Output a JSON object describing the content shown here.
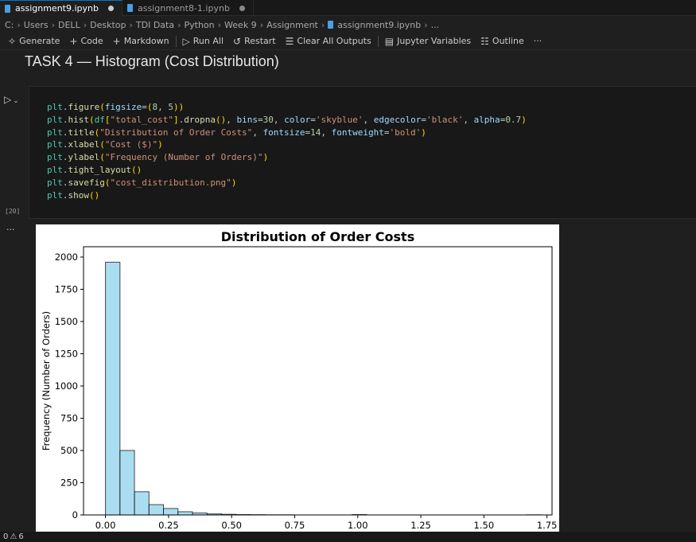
{
  "tabs": [
    {
      "label": "assignment9.ipynb"
    },
    {
      "label": "assignment8-1.ipynb"
    }
  ],
  "breadcrumb": [
    "C:",
    "Users",
    "DELL",
    "Desktop",
    "TDI Data",
    "Python",
    "Week 9",
    "Assignment",
    "assignment9.ipynb",
    "..."
  ],
  "toolbar": {
    "generate": "Generate",
    "code": "Code",
    "markdown": "Markdown",
    "run_all": "Run All",
    "restart": "Restart",
    "clear_all": "Clear All Outputs",
    "jupyter_vars": "Jupyter Variables",
    "outline": "Outline",
    "more": "···"
  },
  "markdown_heading": "TASK 4 — Histogram (Cost Distribution)",
  "cell": {
    "execution_count": "[20]",
    "code_lines": [
      "plt.figure(figsize=(8, 5))",
      "plt.hist(df[\"total_cost\"].dropna(), bins=30, color='skyblue', edgecolor='black', alpha=0.7)",
      "plt.title(\"Distribution of Order Costs\", fontsize=14, fontweight='bold')",
      "plt.xlabel(\"Cost ($)\")",
      "plt.ylabel(\"Frequency (Number of Orders)\")",
      "plt.tight_layout()",
      "plt.savefig(\"cost_distribution.png\")",
      "plt.show()"
    ]
  },
  "output_dots": "···",
  "chart_data": {
    "type": "bar",
    "title": "Distribution of Order Costs",
    "xlabel": "",
    "ylabel": "Frequency (Number of Orders)",
    "xlim": [
      -0.087,
      1.77
    ],
    "ylim": [
      0,
      2080
    ],
    "xticks": [
      "0.00",
      "0.25",
      "0.50",
      "0.75",
      "1.00",
      "1.25",
      "1.50",
      "1.75"
    ],
    "yticks": [
      "0",
      "250",
      "500",
      "750",
      "1000",
      "1250",
      "1500",
      "1750",
      "2000"
    ],
    "bin_start": 0.0,
    "bin_width": 0.0575,
    "values": [
      1960,
      500,
      180,
      80,
      50,
      25,
      15,
      8,
      5,
      3,
      2,
      1,
      1,
      0,
      0,
      0,
      0,
      3,
      0,
      0,
      0,
      0,
      0,
      0,
      0,
      0,
      0,
      0,
      0,
      1
    ],
    "bar_color": "#87ceeb",
    "edge_color": "#000000",
    "alpha": 0.7,
    "grid": false
  },
  "status": {
    "errors": "0",
    "warnings": "6"
  }
}
